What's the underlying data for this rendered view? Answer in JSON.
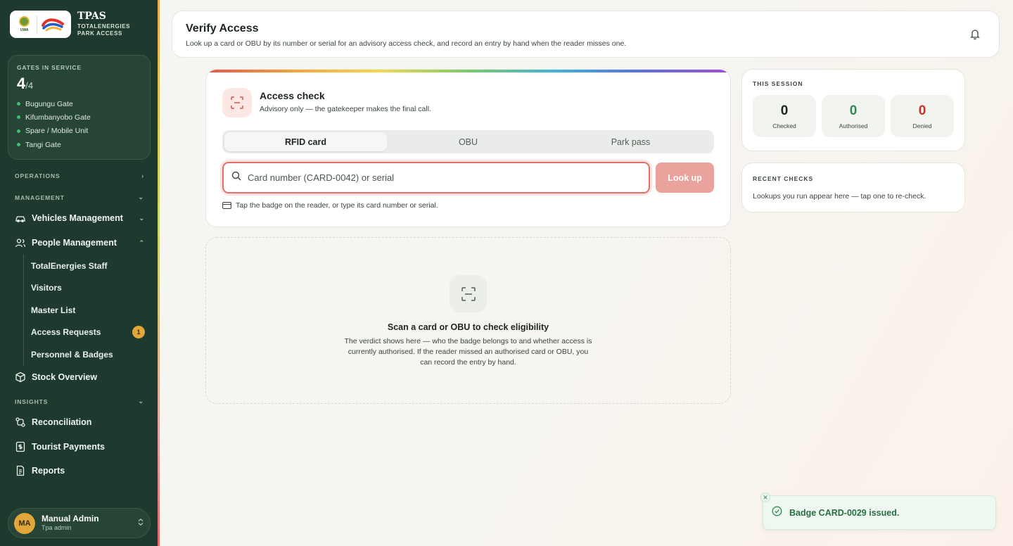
{
  "brand": {
    "title": "TPAS",
    "subtitle_line1": "TOTALENERGIES",
    "subtitle_line2": "PARK ACCESS",
    "logo_text": "UWA"
  },
  "gates": {
    "label": "GATES IN SERVICE",
    "in_service": "4",
    "total": "/4",
    "list": [
      "Bugungu Gate",
      "Kifumbanyobo Gate",
      "Spare / Mobile Unit",
      "Tangi Gate"
    ]
  },
  "nav": {
    "operations": "OPERATIONS",
    "management": "MANAGEMENT",
    "vehicles": "Vehicles Management",
    "people": "People Management",
    "people_sub": [
      "TotalEnergies Staff",
      "Visitors",
      "Master List",
      "Access Requests",
      "Personnel & Badges"
    ],
    "access_requests_count": "1",
    "stock": "Stock Overview",
    "insights": "INSIGHTS",
    "reconciliation": "Reconciliation",
    "tourist_payments": "Tourist Payments",
    "reports": "Reports"
  },
  "user": {
    "initials": "MA",
    "name": "Manual Admin",
    "role": "Tpa admin"
  },
  "header": {
    "title": "Verify Access",
    "description": "Look up a card or OBU by its number or serial for an advisory access check, and record an entry by hand when the reader misses one."
  },
  "check": {
    "title": "Access check",
    "subtitle": "Advisory only — the gatekeeper makes the final call.",
    "tabs": [
      "RFID card",
      "OBU",
      "Park pass"
    ],
    "active_tab": "RFID card",
    "placeholder": "Card number (CARD-0042) or serial",
    "lookup_label": "Look up",
    "hint": "Tap the badge on the reader, or type its card number or serial."
  },
  "empty": {
    "title": "Scan a card or OBU to check eligibility",
    "description": "The verdict shows here — who the badge belongs to and whether access is currently authorised. If the reader missed an authorised card or OBU, you can record the entry by hand."
  },
  "session": {
    "label": "THIS SESSION",
    "stats": [
      {
        "value": "0",
        "label": "Checked",
        "color": "#1d2621"
      },
      {
        "value": "0",
        "label": "Authorised",
        "color": "#2f8a53"
      },
      {
        "value": "0",
        "label": "Denied",
        "color": "#c9302c"
      }
    ]
  },
  "recent": {
    "label": "RECENT CHECKS",
    "description": "Lookups you run appear here — tap one to re-check."
  },
  "toast": {
    "message": "Badge CARD-0029 issued."
  },
  "colors": {
    "sidebar": "#1e3a2f",
    "accent": "#e2716a",
    "success": "#2f8a53",
    "badge": "#e2a73b"
  }
}
